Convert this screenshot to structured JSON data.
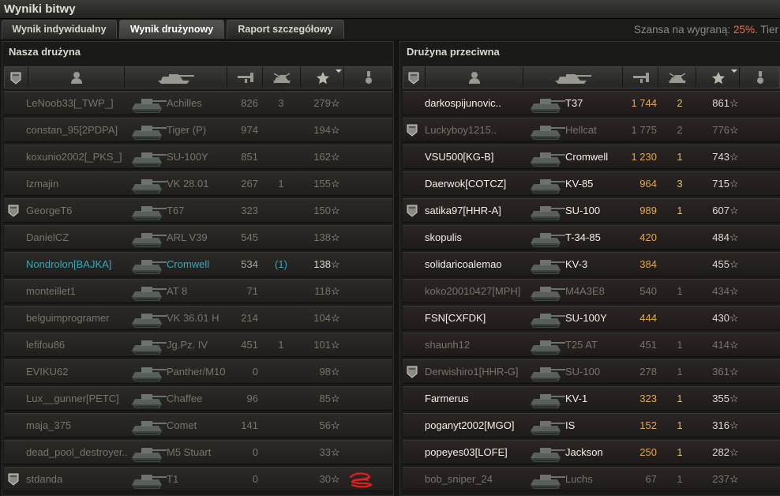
{
  "window": {
    "title": "Wyniki bitwy"
  },
  "tabs": [
    {
      "label": "Wynik indywidualny"
    },
    {
      "label": "Wynik drużynowy"
    },
    {
      "label": "Raport szczegółowy"
    }
  ],
  "active_tab": 1,
  "win_chance": {
    "label": "Szansa na wygraną:",
    "value": "25%.",
    "tier_label": "Tier"
  },
  "icons": {
    "rank": "rank-badge-icon",
    "player": "player-icon",
    "vehicle": "tank-silhouette-icon",
    "damage": "damage-icon",
    "kills": "destroyed-tank-icon",
    "xp": "star-icon",
    "medal": "medal-icon",
    "sort": "sort-arrow-icon"
  },
  "colors": {
    "win_chance": "#e07150",
    "player_highlight": "#3aa5b8",
    "kills": "#d4c070",
    "enemy_damage": "#d6a14a"
  },
  "our_team": {
    "title": "Nasza drużyna",
    "rows": [
      {
        "name": "LeNoob33[_TWP_]",
        "vehicle": "Achilles",
        "damage": "826",
        "kills": "3",
        "xp": "279",
        "rank": false,
        "state": "dim"
      },
      {
        "name": "constan_95[2PDPA]",
        "vehicle": "Tiger (P)",
        "damage": "974",
        "kills": "",
        "xp": "194",
        "rank": false,
        "state": "dim"
      },
      {
        "name": "koxunio2002[_PKS_]",
        "vehicle": "SU-100Y",
        "damage": "851",
        "kills": "",
        "xp": "162",
        "rank": false,
        "state": "dim"
      },
      {
        "name": "Izmajin",
        "vehicle": "VK 28.01",
        "damage": "267",
        "kills": "1",
        "xp": "155",
        "rank": false,
        "state": "dim"
      },
      {
        "name": "GeorgeT6",
        "vehicle": "T67",
        "damage": "323",
        "kills": "",
        "xp": "150",
        "rank": true,
        "state": "dim"
      },
      {
        "name": "DanielCZ",
        "vehicle": "ARL V39",
        "damage": "545",
        "kills": "",
        "xp": "138",
        "rank": false,
        "state": "dim"
      },
      {
        "name": "Nondrolon[BAJKA]",
        "vehicle": "Cromwell",
        "damage": "534",
        "kills": "(1)",
        "xp": "138",
        "rank": false,
        "state": "player"
      },
      {
        "name": "monteillet1",
        "vehicle": "AT 8",
        "damage": "71",
        "kills": "",
        "xp": "118",
        "rank": false,
        "state": "dim"
      },
      {
        "name": "belguimprogramer",
        "vehicle": "VK 36.01 H",
        "damage": "214",
        "kills": "",
        "xp": "104",
        "rank": false,
        "state": "dim"
      },
      {
        "name": "lefifou86",
        "vehicle": "Jg.Pz. IV",
        "damage": "451",
        "kills": "1",
        "xp": "101",
        "rank": false,
        "state": "dim"
      },
      {
        "name": "EVIKU62",
        "vehicle": "Panther/M10",
        "damage": "0",
        "kills": "",
        "xp": "98",
        "rank": false,
        "state": "dim"
      },
      {
        "name": "Lux__gunner[PETC]",
        "vehicle": "Chaffee",
        "damage": "96",
        "kills": "",
        "xp": "85",
        "rank": false,
        "state": "dim"
      },
      {
        "name": "maja_375",
        "vehicle": "Comet",
        "damage": "141",
        "kills": "",
        "xp": "56",
        "rank": false,
        "state": "dim"
      },
      {
        "name": "dead_pool_destroyer..",
        "vehicle": "M5 Stuart",
        "damage": "0",
        "kills": "",
        "xp": "33",
        "rank": false,
        "state": "dim"
      },
      {
        "name": "stdanda",
        "vehicle": "T1",
        "damage": "0",
        "kills": "",
        "xp": "30",
        "rank": true,
        "state": "dim"
      }
    ]
  },
  "enemy_team": {
    "title": "Drużyna przeciwna",
    "rows": [
      {
        "name": "darkospijunovic..",
        "vehicle": "T37",
        "damage": "1 744",
        "kills": "2",
        "xp": "861",
        "rank": false,
        "state": "bright"
      },
      {
        "name": "Luckyboy1215..",
        "vehicle": "Hellcat",
        "damage": "1 775",
        "kills": "2",
        "xp": "776",
        "rank": true,
        "state": "dim"
      },
      {
        "name": "VSU500[KG-B]",
        "vehicle": "Cromwell",
        "damage": "1 230",
        "kills": "1",
        "xp": "743",
        "rank": false,
        "state": "bright"
      },
      {
        "name": "Daerwok[COTCZ]",
        "vehicle": "KV-85",
        "damage": "964",
        "kills": "3",
        "xp": "715",
        "rank": false,
        "state": "bright"
      },
      {
        "name": "satika97[HHR-A]",
        "vehicle": "SU-100",
        "damage": "989",
        "kills": "1",
        "xp": "607",
        "rank": true,
        "state": "bright"
      },
      {
        "name": "skopulis",
        "vehicle": "T-34-85",
        "damage": "420",
        "kills": "",
        "xp": "484",
        "rank": false,
        "state": "bright"
      },
      {
        "name": "solidaricoalemao",
        "vehicle": "KV-3",
        "damage": "384",
        "kills": "",
        "xp": "455",
        "rank": false,
        "state": "bright"
      },
      {
        "name": "koko20010427[MPH]",
        "vehicle": "M4A3E8",
        "damage": "540",
        "kills": "1",
        "xp": "434",
        "rank": false,
        "state": "dim"
      },
      {
        "name": "FSN[CXFDK]",
        "vehicle": "SU-100Y",
        "damage": "444",
        "kills": "",
        "xp": "430",
        "rank": false,
        "state": "bright"
      },
      {
        "name": "shaunh12",
        "vehicle": "T25 AT",
        "damage": "451",
        "kills": "1",
        "xp": "414",
        "rank": false,
        "state": "dim"
      },
      {
        "name": "Derwishiro1[HHR-G]",
        "vehicle": "SU-100",
        "damage": "278",
        "kills": "1",
        "xp": "361",
        "rank": true,
        "state": "dim"
      },
      {
        "name": "Farmerus",
        "vehicle": "KV-1",
        "damage": "323",
        "kills": "1",
        "xp": "355",
        "rank": false,
        "state": "bright"
      },
      {
        "name": "poganyt2002[MGO]",
        "vehicle": "IS",
        "damage": "152",
        "kills": "1",
        "xp": "316",
        "rank": false,
        "state": "bright"
      },
      {
        "name": "popeyes03[LOFE]",
        "vehicle": "Jackson",
        "damage": "250",
        "kills": "1",
        "xp": "282",
        "rank": false,
        "state": "bright"
      },
      {
        "name": "bob_sniper_24",
        "vehicle": "Luchs",
        "damage": "67",
        "kills": "1",
        "xp": "237",
        "rank": false,
        "state": "dim"
      }
    ]
  }
}
